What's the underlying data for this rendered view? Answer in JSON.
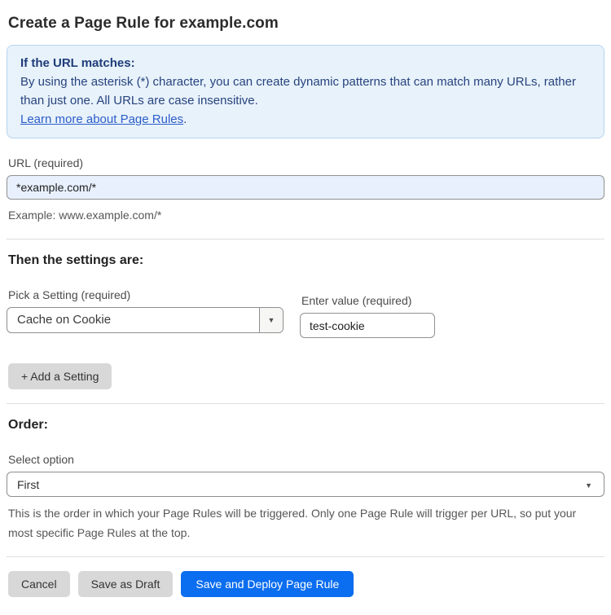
{
  "page": {
    "title": "Create a Page Rule for example.com"
  },
  "info_box": {
    "heading": "If the URL matches:",
    "body": "By using the asterisk (*) character, you can create dynamic patterns that can match many URLs, rather than just one. All URLs are case insensitive.",
    "link_label": "Learn more about Page Rules",
    "link_suffix": "."
  },
  "url_field": {
    "label": "URL (required)",
    "value": "*example.com/*",
    "helper": "Example: www.example.com/*"
  },
  "settings": {
    "heading": "Then the settings are:",
    "setting_label": "Pick a Setting (required)",
    "setting_value": "Cache on Cookie",
    "value_label": "Enter value (required)",
    "value_value": "test-cookie",
    "add_button_label": "+ Add a Setting"
  },
  "order": {
    "heading": "Order:",
    "label": "Select option",
    "value": "First",
    "helper": "This is the order in which your Page Rules will be triggered. Only one Page Rule will trigger per URL, so put your most specific Page Rules at the top."
  },
  "actions": {
    "cancel_label": "Cancel",
    "save_draft_label": "Save as Draft",
    "save_deploy_label": "Save and Deploy Page Rule"
  },
  "icons": {
    "dropdown_arrow": "▼"
  },
  "colors": {
    "primary_button": "#0b6def",
    "info_background": "#e8f2fb",
    "info_border": "#b6d4ef",
    "info_text": "#27447e",
    "link": "#2c5ec9",
    "url_input_background": "#e8f0fe"
  }
}
